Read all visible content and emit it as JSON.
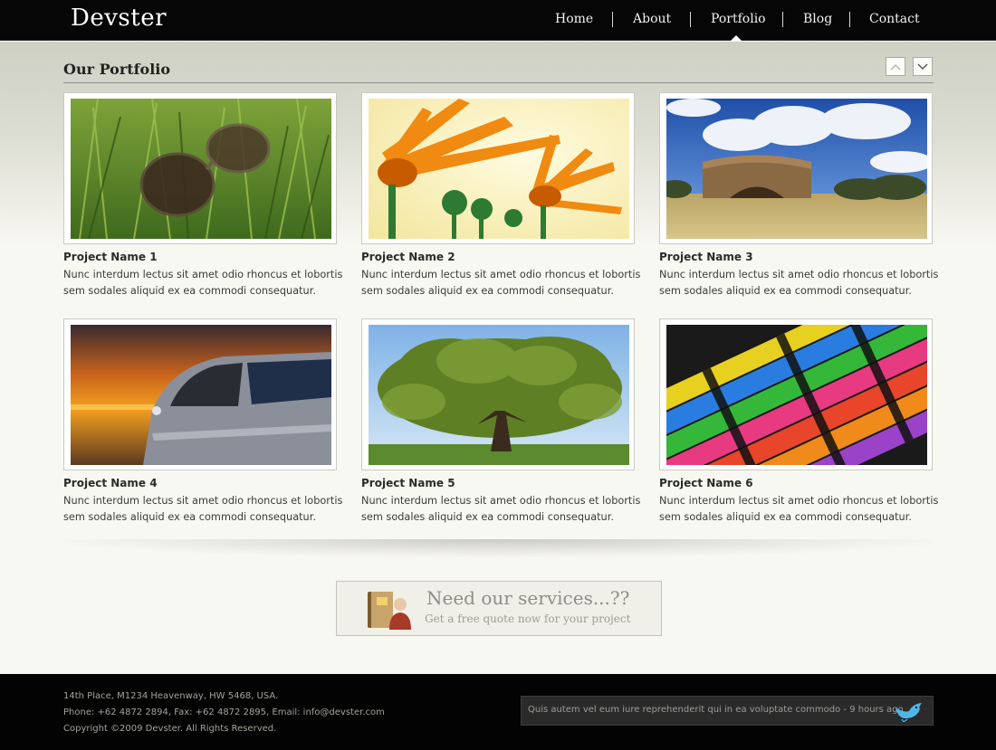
{
  "header": {
    "logo": "Devster",
    "nav": [
      {
        "label": "Home"
      },
      {
        "label": "About"
      },
      {
        "label": "Portfolio",
        "active": true
      },
      {
        "label": "Blog"
      },
      {
        "label": "Contact"
      }
    ]
  },
  "portfolio": {
    "title": "Our Portfolio",
    "arrow_up_icon": "chevron-up-icon",
    "arrow_down_icon": "chevron-down-icon",
    "projects": [
      {
        "title": "Project Name 1",
        "desc_1": "Nunc interdum lectus sit amet odio rhoncus et lobortis",
        "desc_2": "sem sodales aliquid ex ea commodi consequatur.",
        "image": "sunglasses-in-grass-photo"
      },
      {
        "title": "Project Name 2",
        "desc_1": "Nunc interdum lectus sit amet odio rhoncus et lobortis",
        "desc_2": "sem sodales aliquid ex ea commodi consequatur.",
        "image": "orange-flowers-photo"
      },
      {
        "title": "Project Name 3",
        "desc_1": "Nunc interdum lectus sit amet odio rhoncus et lobortis",
        "desc_2": "sem sodales aliquid ex ea commodi consequatur.",
        "image": "stone-structure-photo"
      },
      {
        "title": "Project Name 4",
        "desc_1": "Nunc interdum lectus sit amet odio rhoncus et lobortis",
        "desc_2": "sem sodales aliquid ex ea commodi consequatur.",
        "image": "car-at-sunset-photo"
      },
      {
        "title": "Project Name 5",
        "desc_1": "Nunc interdum lectus sit amet odio rhoncus et lobortis",
        "desc_2": "sem sodales aliquid ex ea commodi consequatur.",
        "image": "oak-tree-photo"
      },
      {
        "title": "Project Name 6",
        "desc_1": "Nunc interdum lectus sit amet odio rhoncus et lobortis",
        "desc_2": "sem sodales aliquid ex ea commodi consequatur.",
        "image": "crayons-photo"
      }
    ]
  },
  "cta": {
    "title": "Need our services...??",
    "subtitle": "Get a free quote now for your project",
    "icon": "contact-book-icon"
  },
  "footer": {
    "address": "14th Place, M1234 Heavenway, HW 5468, USA.",
    "contact": "Phone: +62 4872 2894, Fax: +62 4872 2895, Email: info@devster.com",
    "copyright": "Copyright ©2009 Devster. All Rights Reserved.",
    "tweet": "Quis autem vel eum iure reprehenderit qui in ea voluptate commodo - 9 hours ago",
    "tweet_icon": "twitter-bird-icon"
  },
  "colors": {
    "header_bg": "#060606",
    "page_bg": "#f8f8f2",
    "footer_bg": "#030303",
    "tweet_bg": "#2a2a2a"
  }
}
